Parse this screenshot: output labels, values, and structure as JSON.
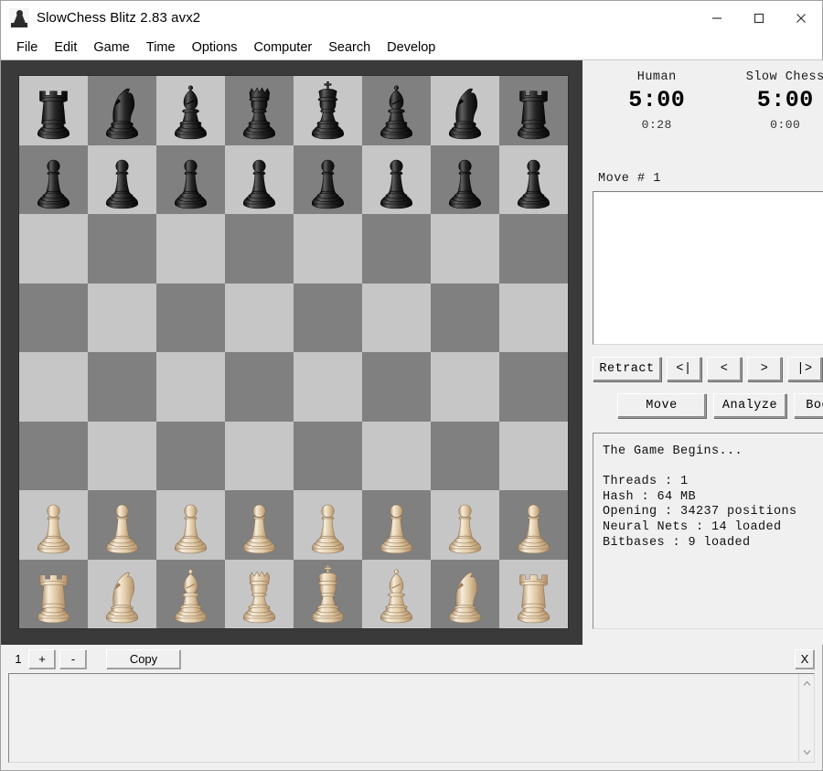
{
  "window": {
    "title": "SlowChess Blitz 2.83 avx2",
    "icon": "chess-pawn-icon",
    "controls": {
      "minimize": "minimize-icon",
      "maximize": "maximize-icon",
      "close": "close-icon"
    }
  },
  "menubar": {
    "items": [
      {
        "label": "File"
      },
      {
        "label": "Edit"
      },
      {
        "label": "Game"
      },
      {
        "label": "Time"
      },
      {
        "label": "Options"
      },
      {
        "label": "Computer"
      },
      {
        "label": "Search"
      },
      {
        "label": "Develop"
      }
    ]
  },
  "board": {
    "light_color": "#c6c6c6",
    "dark_color": "#808080",
    "frame_color": "#3a3a3a",
    "white_piece_color": "#e5d3b3",
    "black_piece_color": "#1e1e1e",
    "orientation": "white-bottom",
    "ranks": [
      [
        "r",
        "n",
        "b",
        "q",
        "k",
        "b",
        "n",
        "r"
      ],
      [
        "p",
        "p",
        "p",
        "p",
        "p",
        "p",
        "p",
        "p"
      ],
      [
        "",
        "",
        "",
        "",
        "",
        "",
        "",
        ""
      ],
      [
        "",
        "",
        "",
        "",
        "",
        "",
        "",
        ""
      ],
      [
        "",
        "",
        "",
        "",
        "",
        "",
        "",
        ""
      ],
      [
        "",
        "",
        "",
        "",
        "",
        "",
        "",
        ""
      ],
      [
        "P",
        "P",
        "P",
        "P",
        "P",
        "P",
        "P",
        "P"
      ],
      [
        "R",
        "N",
        "B",
        "Q",
        "K",
        "B",
        "N",
        "R"
      ]
    ]
  },
  "panel": {
    "clocks": [
      {
        "name": "Human",
        "time": "5:00",
        "elapsed": "0:28"
      },
      {
        "name": "Slow Chess",
        "time": "5:00",
        "elapsed": "0:00"
      }
    ],
    "move_label": "Move # 1",
    "movelist_text": "",
    "buttons_row1": [
      {
        "label": "Retract",
        "name": "retract-button"
      },
      {
        "label": "<|",
        "name": "first-move-button"
      },
      {
        "label": "<",
        "name": "prev-move-button"
      },
      {
        "label": ">",
        "name": "next-move-button"
      },
      {
        "label": "|>",
        "name": "last-move-button"
      }
    ],
    "buttons_row2": [
      {
        "label": "Move",
        "name": "move-button"
      },
      {
        "label": "Analyze",
        "name": "analyze-button"
      },
      {
        "label": "Book",
        "name": "book-button"
      }
    ],
    "info_lines": [
      "The Game Begins...",
      "",
      "Threads : 1",
      "Hash : 64 MB",
      "Opening : 34237 positions",
      "Neural Nets : 14 loaded",
      "Bitbases : 9 loaded"
    ]
  },
  "bottom_toolbar": {
    "count": "1",
    "increase_label": "+",
    "decrease_label": "-",
    "copy_label": "Copy",
    "close_label": "X"
  },
  "bottom_pane": {
    "text": "",
    "scroll_up": "scroll-up-arrow-icon",
    "scroll_down": "scroll-down-arrow-icon"
  }
}
